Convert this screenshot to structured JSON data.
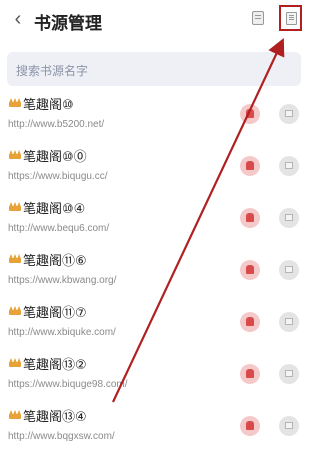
{
  "header": {
    "back_icon": "back-chevron-icon",
    "title": "书源管理",
    "icons": [
      "copy-icon",
      "document-icon"
    ]
  },
  "search": {
    "placeholder": "搜索书源名字"
  },
  "sources": [
    {
      "name": "笔趣阁⑩",
      "url": "http://www.b5200.net/"
    },
    {
      "name": "笔趣阁⑩⓪",
      "url": "https://www.biqugu.cc/"
    },
    {
      "name": "笔趣阁⑩④",
      "url": "http://www.bequ6.com/"
    },
    {
      "name": "笔趣阁⑪⑥",
      "url": "https://www.kbwang.org/"
    },
    {
      "name": "笔趣阁⑪⑦",
      "url": "http://www.xbiquke.com/"
    },
    {
      "name": "笔趣阁⑬②",
      "url": "https://www.biquge98.com/"
    },
    {
      "name": "笔趣阁⑬④",
      "url": "http://www.bqgxsw.com/"
    }
  ],
  "annotation": {
    "color": "#b02020"
  }
}
